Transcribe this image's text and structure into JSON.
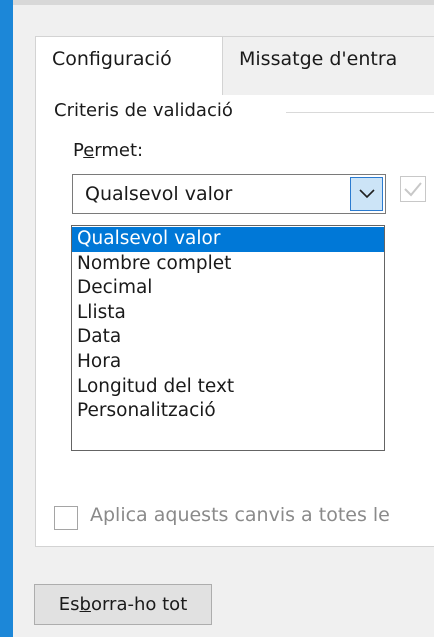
{
  "tabs": [
    {
      "label": "Configuració",
      "active": true
    },
    {
      "label": "Missatge d'entra",
      "active": false
    }
  ],
  "criteria": {
    "group_title": "Criteris de validació",
    "allow_label": {
      "before": "P",
      "underlined": "e",
      "after": "rmet:"
    },
    "allow_value": "Qualsevol valor",
    "options": [
      "Qualsevol valor",
      "Nombre complet",
      "Decimal",
      "Llista",
      "Data",
      "Hora",
      "Longitud del text",
      "Personalització"
    ],
    "selected_index": 0
  },
  "apply_all": {
    "label": "Aplica aquests canvis a totes le",
    "checked": false
  },
  "clear_all_button": {
    "before": "Es",
    "underlined": "b",
    "after": "orra-ho tot"
  },
  "icons": {
    "dropdown": "chevron-down-icon",
    "checkbox": "checkmark-icon"
  },
  "colors": {
    "accent": "#0078d7",
    "window_border": "#1c87d8",
    "combo_button": "#cce4f7"
  }
}
